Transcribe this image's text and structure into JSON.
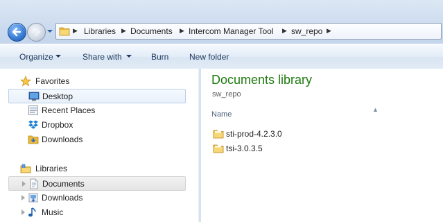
{
  "address_bar": {
    "breadcrumbs": [
      "Libraries",
      "Documents",
      "Intercom Manager Tool",
      "sw_repo"
    ]
  },
  "toolbar": {
    "organize_label": "Organize",
    "share_with_label": "Share with",
    "burn_label": "Burn",
    "new_folder_label": "New folder"
  },
  "nav_pane": {
    "favorites": {
      "label": "Favorites",
      "items": [
        {
          "label": "Desktop",
          "icon": "desktop-icon",
          "state": "hover"
        },
        {
          "label": "Recent Places",
          "icon": "recent-places-icon"
        },
        {
          "label": "Dropbox",
          "icon": "dropbox-icon"
        },
        {
          "label": "Downloads",
          "icon": "downloads-folder-icon"
        }
      ]
    },
    "libraries": {
      "label": "Libraries",
      "items": [
        {
          "label": "Documents",
          "icon": "documents-library-icon",
          "state": "selected"
        },
        {
          "label": "Downloads",
          "icon": "downloads-library-icon"
        },
        {
          "label": "Music",
          "icon": "music-library-icon"
        }
      ]
    }
  },
  "content": {
    "library_title": "Documents library",
    "library_subtitle": "sw_repo",
    "column_header": "Name",
    "files": [
      {
        "name": "sti-prod-4.2.3.0",
        "icon": "folder-icon"
      },
      {
        "name": "tsi-3.0.3.5",
        "icon": "folder-icon"
      }
    ]
  },
  "colors": {
    "library_title": "#1e7a0e",
    "toolbar_text": "#1e395b"
  }
}
